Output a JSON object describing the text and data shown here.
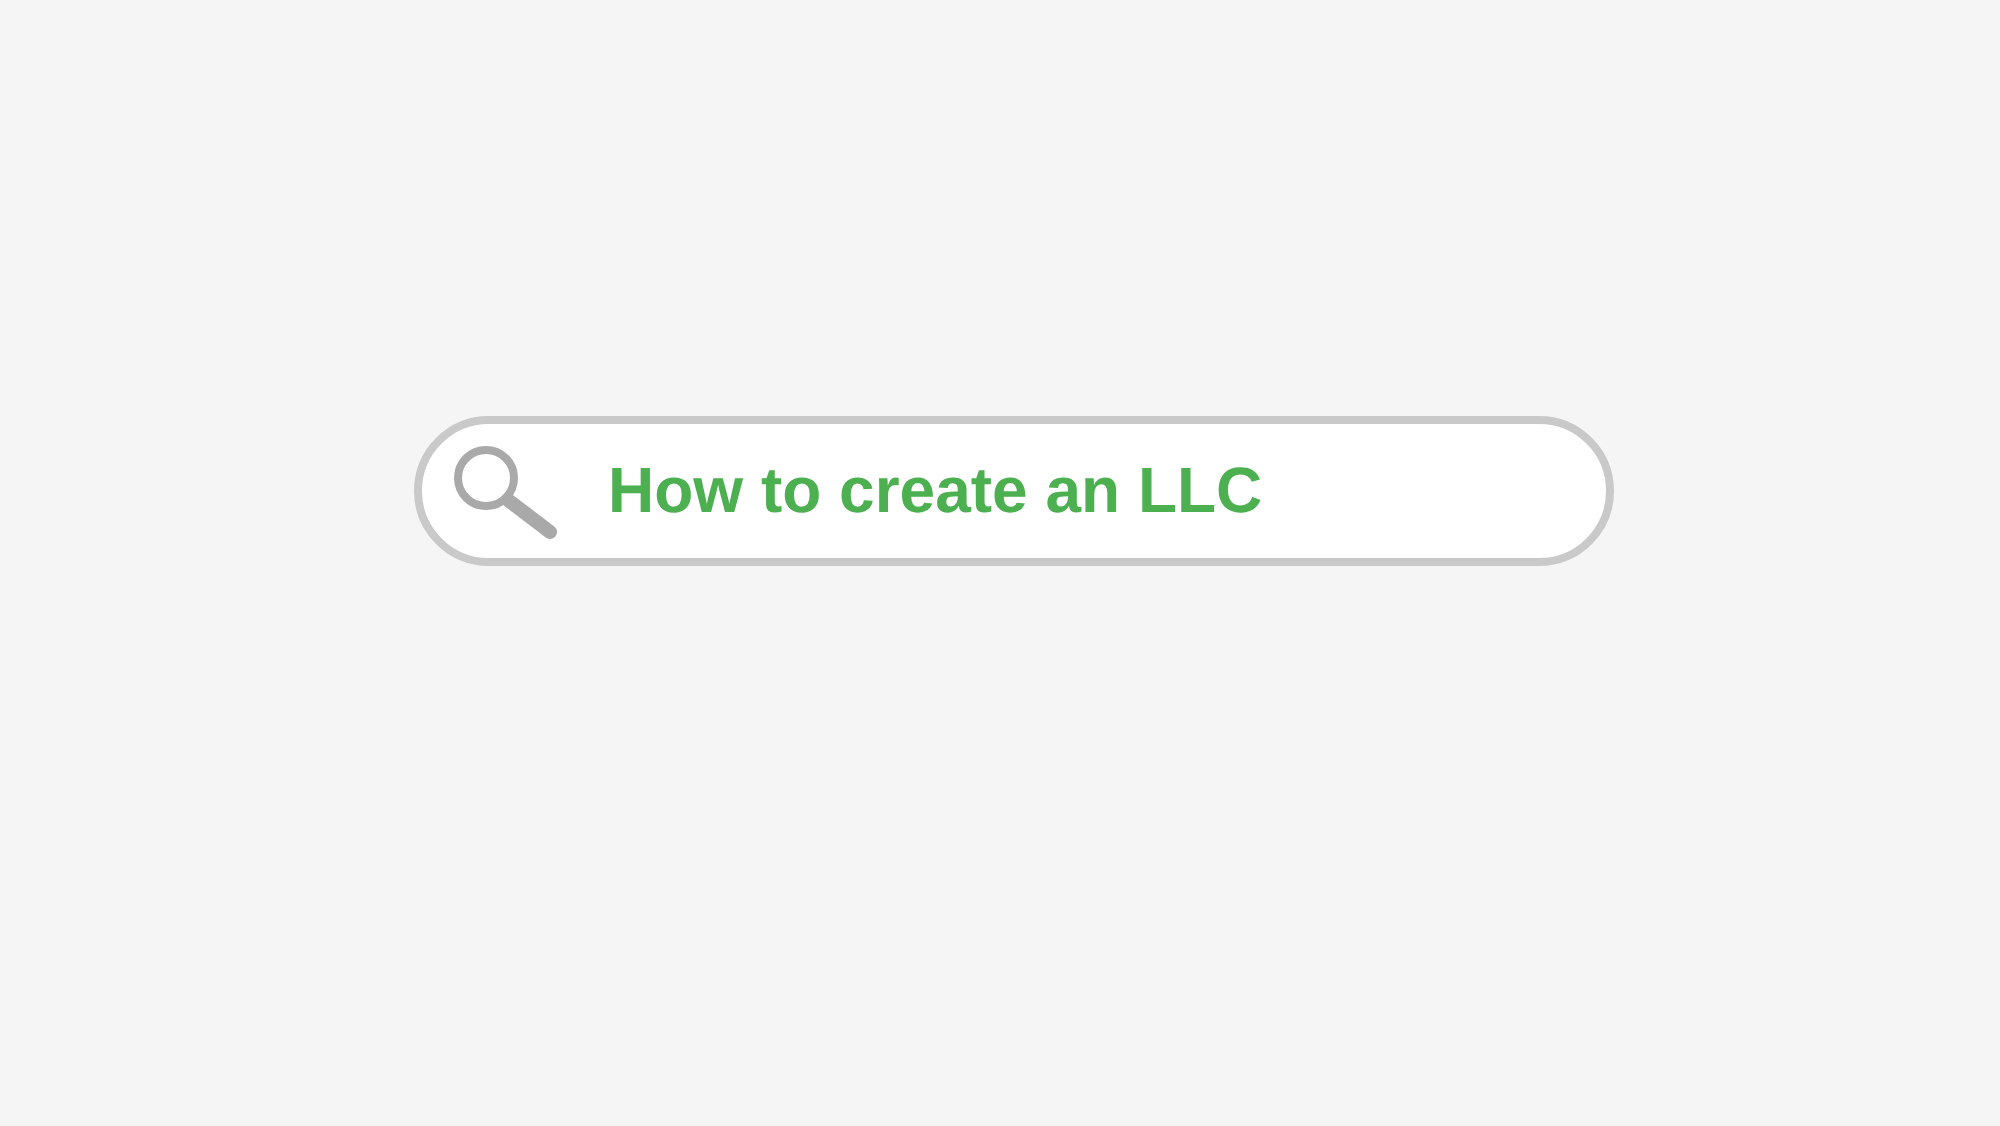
{
  "search": {
    "value": "How to create an LLC"
  }
}
